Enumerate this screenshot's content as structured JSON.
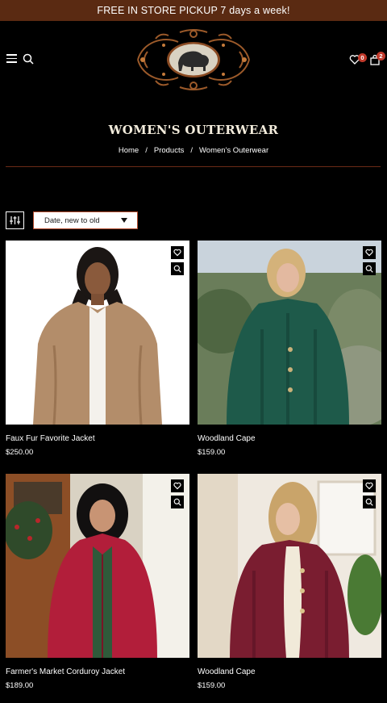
{
  "announcement": "FREE IN STORE PICKUP 7 days a week!",
  "header": {
    "wishlist_count": "0",
    "cart_count": "2"
  },
  "page": {
    "title": "WOMEN'S OUTERWEAR",
    "breadcrumb": [
      "Home",
      "Products",
      "Women's Outerwear"
    ]
  },
  "toolbar": {
    "sort_selected": "Date, new to old"
  },
  "products": [
    {
      "name": "Faux Fur Favorite Jacket",
      "price": "$250.00"
    },
    {
      "name": "Woodland Cape",
      "price": "$159.00"
    },
    {
      "name": "Farmer's Market Corduroy Jacket",
      "price": "$189.00"
    },
    {
      "name": "Woodland Cape",
      "price": "$159.00"
    }
  ],
  "colors": {
    "announcement_bg": "#5a2a12",
    "accent": "#b54b2c",
    "badge": "#c0392b"
  }
}
